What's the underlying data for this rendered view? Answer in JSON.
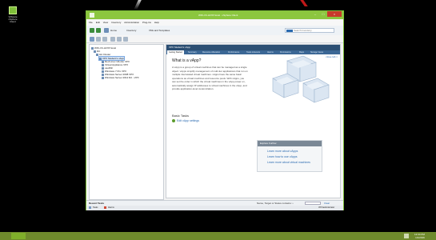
{
  "desktop": {
    "icon_label": "VMware vSphere Client"
  },
  "window": {
    "title": "WIN-VC-HOST.local - vSphere Client",
    "min": "–",
    "max": "□",
    "close": "×"
  },
  "menubar": [
    "File",
    "Edit",
    "View",
    "Inventory",
    "Administration",
    "Plug-ins",
    "Help"
  ],
  "nav": {
    "home": "Home",
    "inventory": "Inventory",
    "vms": "VMs and Templates"
  },
  "search": {
    "placeholder": "Search Inventory"
  },
  "tree": [
    {
      "label": "WIN-VC-HOST.local",
      "level": 0
    },
    {
      "label": "DC",
      "level": 1
    },
    {
      "label": "HA Cluster",
      "level": 2
    },
    {
      "label": "VPX Student's vApp",
      "level": 3,
      "selected": true
    },
    {
      "label": "Red Linux Ubuntu VPX",
      "level": 4
    },
    {
      "label": "Virtual Appliance VPX",
      "level": 4
    },
    {
      "label": "vaultSF",
      "level": 4
    },
    {
      "label": "Windows 7 Pro VPX",
      "level": 4
    },
    {
      "label": "Windows Server 2008 VPX",
      "level": 4
    },
    {
      "label": "Windows Server 2012 R2 - VPX",
      "level": 4
    }
  ],
  "pane": {
    "header": "VPX Student's vApp",
    "tabs": [
      "Getting Started",
      "Summary",
      "Resource Allocation",
      "Performance",
      "Tasks & Events",
      "Alarms",
      "Permissions",
      "Maps",
      "Storage Views"
    ],
    "close_tab": "close tab ×",
    "what_title": "What is a vApp?",
    "what_body": "A vApp is a group of virtual machines that can be managed as a single object. vApps simplify management of multi-tier applications that run on multiple interrelated virtual machines. vApps have the same basic operations as virtual machines and resource pools. With vApps, you can set the order in which the virtual machines in the vApp power on, automatically assign IP addresses to virtual machines in the vApp, and provide application-level customization.",
    "basic_title": "Basic Tasks",
    "basic_link": "Edit vApp settings",
    "explore_title": "Explore Further",
    "explore_links": [
      "Learn more about vApps",
      "Learn how to use vApps",
      "Learn more about virtual machines"
    ]
  },
  "tasks": {
    "title": "Recent Tasks",
    "filter_label": "Name, Target or Status contains: •",
    "clear": "Clear",
    "columns": [
      "Name",
      "Target",
      "Status",
      "Details",
      "Initiated by",
      "vCenter Server",
      "Requested Start Ti...",
      "Start Time",
      "Completed Time"
    ]
  },
  "status": {
    "tasks": "Tasks",
    "alarms": "Alarms",
    "user": "VPX\\administrator"
  },
  "taskbar": {
    "time": "12:34 PM",
    "date": "1/1/2016"
  },
  "colors": {
    "accent": "#8cc63f",
    "taskbar": "#6f8a2c",
    "pane_header": "#2c4f73",
    "link": "#2a6ab0"
  }
}
